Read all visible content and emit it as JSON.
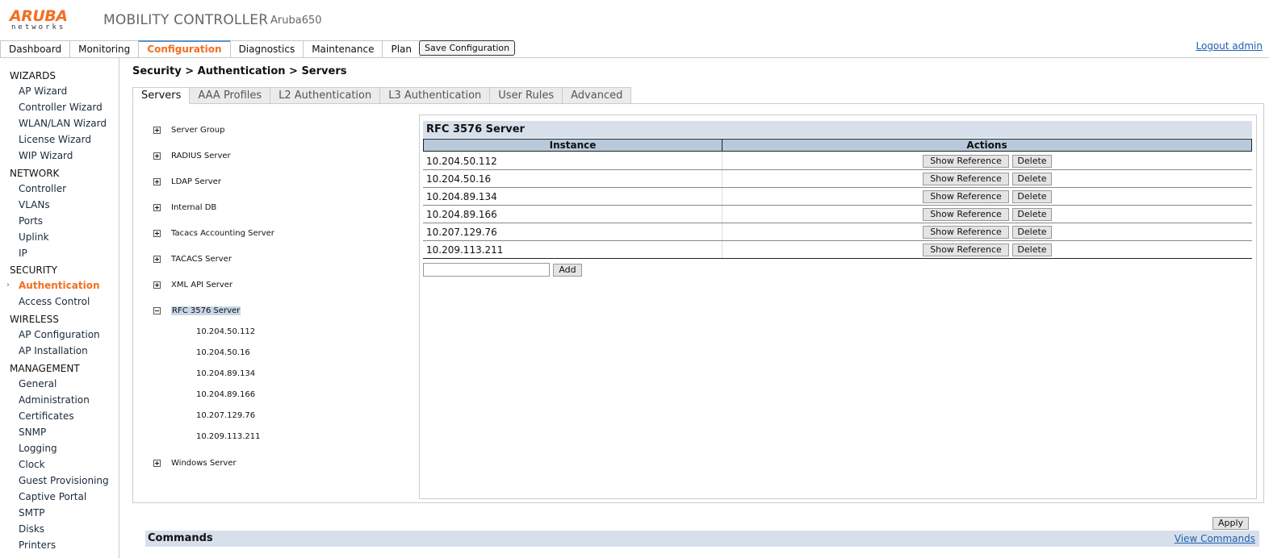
{
  "header": {
    "logo_main": "ARUBA",
    "logo_sub": "networks",
    "app_title": "MOBILITY CONTROLLER",
    "device_name": "Aruba650",
    "save_label": "Save Configuration",
    "logout_label": "Logout admin"
  },
  "topnav": {
    "tabs": [
      "Dashboard",
      "Monitoring",
      "Configuration",
      "Diagnostics",
      "Maintenance",
      "Plan"
    ],
    "active": "Configuration"
  },
  "sidebar": {
    "sections": [
      {
        "title": "WIZARDS",
        "items": [
          "AP Wizard",
          "Controller Wizard",
          "WLAN/LAN Wizard",
          "License Wizard",
          "WIP Wizard"
        ]
      },
      {
        "title": "NETWORK",
        "items": [
          "Controller",
          "VLANs",
          "Ports",
          "Uplink",
          "IP"
        ]
      },
      {
        "title": "SECURITY",
        "items": [
          "Authentication",
          "Access Control"
        ]
      },
      {
        "title": "WIRELESS",
        "items": [
          "AP Configuration",
          "AP Installation"
        ]
      },
      {
        "title": "MANAGEMENT",
        "items": [
          "General",
          "Administration",
          "Certificates",
          "SNMP",
          "Logging",
          "Clock",
          "Guest Provisioning",
          "Captive Portal",
          "SMTP",
          "Disks",
          "Printers"
        ]
      }
    ],
    "active_item": "Authentication"
  },
  "main": {
    "breadcrumb": "Security > Authentication > Servers",
    "subtabs": [
      "Servers",
      "AAA Profiles",
      "L2 Authentication",
      "L3 Authentication",
      "User Rules",
      "Advanced"
    ],
    "active_subtab": "Servers"
  },
  "tree": {
    "nodes": [
      "Server Group",
      "RADIUS Server",
      "LDAP Server",
      "Internal DB",
      "Tacacs Accounting Server",
      "TACACS Server",
      "XML API Server",
      "RFC 3576 Server",
      "Windows Server"
    ],
    "expanded": "RFC 3576 Server",
    "children": [
      "10.204.50.112",
      "10.204.50.16",
      "10.204.89.134",
      "10.204.89.166",
      "10.207.129.76",
      "10.209.113.211"
    ]
  },
  "panel": {
    "title": "RFC 3576 Server",
    "columns": [
      "Instance",
      "Actions"
    ],
    "rows": [
      "10.204.50.112",
      "10.204.50.16",
      "10.204.89.134",
      "10.204.89.166",
      "10.207.129.76",
      "10.209.113.211"
    ],
    "show_reference_label": "Show Reference",
    "delete_label": "Delete",
    "add_input_value": "",
    "add_label": "Add"
  },
  "footer": {
    "apply_label": "Apply",
    "commands_title": "Commands",
    "view_commands_label": "View Commands"
  }
}
